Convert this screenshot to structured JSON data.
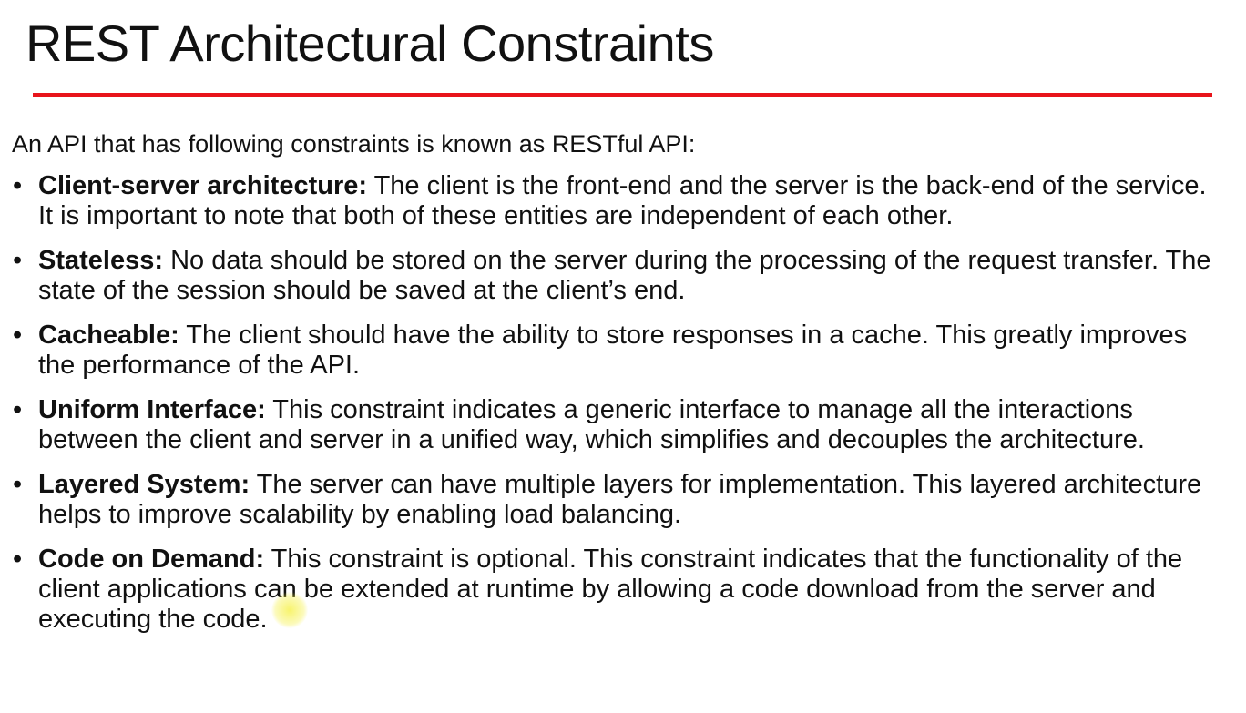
{
  "slide": {
    "title": "REST Architectural Constraints",
    "intro": "An API that has following constraints is known as RESTful API:",
    "bullet_glyph": "•",
    "accent_color": "#e8141b",
    "items": [
      {
        "term": "Client-server architecture:",
        "text": " The client is the front-end and the server is the back-end of the service. It is important to note that both of these entities are independent of each other."
      },
      {
        "term": "Stateless:",
        "text": " No data should be stored on the server during the processing of the request transfer. The state of the session should be saved at the client’s end."
      },
      {
        "term": "Cacheable:",
        "text": " The client should have the ability to store responses in a cache. This greatly improves the performance of the API."
      },
      {
        "term": "Uniform Interface:",
        "text": " This constraint indicates a generic interface to manage all the interactions between the client and server in a unified way, which simplifies and decouples the architecture."
      },
      {
        "term": "Layered System:",
        "text": " The server can have multiple layers for implementation. This layered architecture helps to improve scalability by enabling load balancing."
      },
      {
        "term": "Code on Demand:",
        "text": " This constraint is optional. This constraint indicates that the functionality of the client applications can be extended at runtime by allowing a code download from the server and executing the code."
      }
    ]
  }
}
